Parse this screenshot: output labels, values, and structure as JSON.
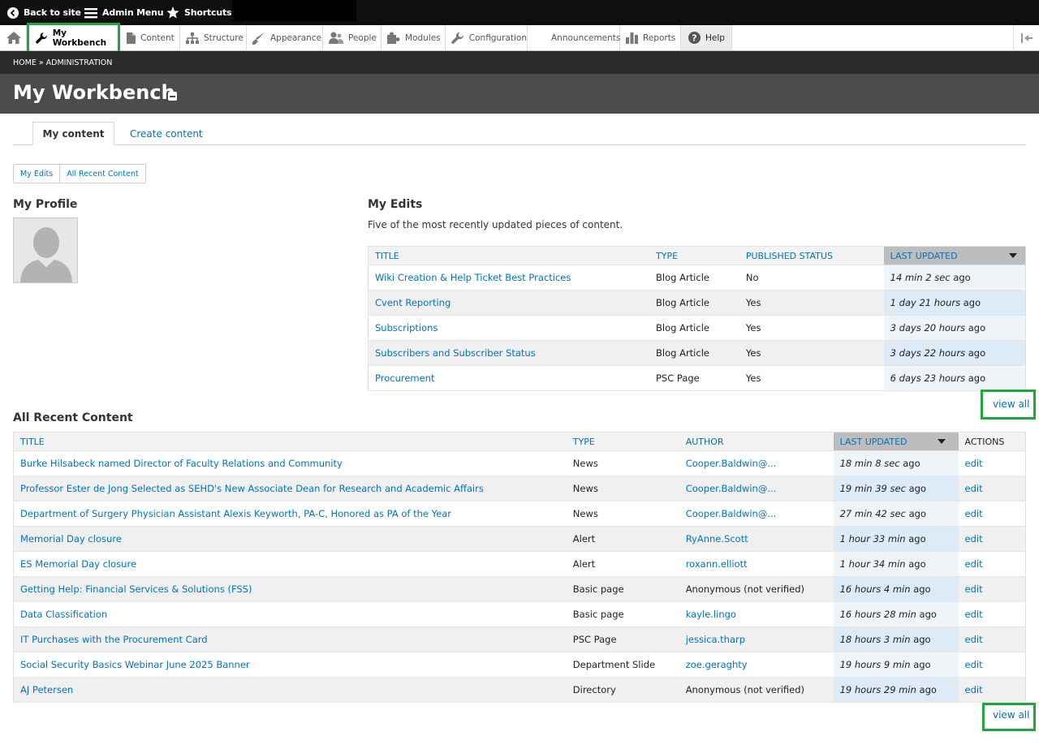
{
  "toolbar": {
    "back_to_site": "Back to site",
    "admin_menu": "Admin Menu",
    "shortcuts": "Shortcuts"
  },
  "tray": {
    "items": [
      {
        "label": "My Workbench"
      },
      {
        "label": "Content"
      },
      {
        "label": "Structure"
      },
      {
        "label": "Appearance"
      },
      {
        "label": "People"
      },
      {
        "label": "Modules"
      },
      {
        "label": "Configuration"
      },
      {
        "label": "Announcements"
      },
      {
        "label": "Reports"
      },
      {
        "label": "Help"
      }
    ]
  },
  "breadcrumb": "HOME » ADMINISTRATION",
  "page_title": "My Workbench",
  "tabs": {
    "active": "My content",
    "other": "Create content"
  },
  "local_buttons": [
    "My Edits",
    "All Recent Content"
  ],
  "profile": {
    "heading": "My Profile"
  },
  "my_edits": {
    "heading": "My Edits",
    "description": "Five of the most recently updated pieces of content.",
    "headers": [
      "TITLE",
      "TYPE",
      "PUBLISHED STATUS",
      "LAST UPDATED"
    ],
    "rows": [
      {
        "title": "Wiki Creation & Help Ticket Best Practices",
        "type": "Blog Article",
        "status": "No",
        "updated": "14 min 2 sec",
        "ago": " ago"
      },
      {
        "title": "Cvent Reporting",
        "type": "Blog Article",
        "status": "Yes",
        "updated": "1 day 21 hours",
        "ago": " ago"
      },
      {
        "title": "Subscriptions",
        "type": "Blog Article",
        "status": "Yes",
        "updated": "3 days 20 hours",
        "ago": " ago"
      },
      {
        "title": "Subscribers and Subscriber Status",
        "type": "Blog Article",
        "status": "Yes",
        "updated": "3 days 22 hours",
        "ago": " ago"
      },
      {
        "title": "Procurement",
        "type": "PSC Page",
        "status": "Yes",
        "updated": "6 days 23 hours",
        "ago": " ago"
      }
    ],
    "view_all": "view all"
  },
  "recent": {
    "heading": "All Recent Content",
    "headers": [
      "TITLE",
      "TYPE",
      "AUTHOR",
      "LAST UPDATED",
      "ACTIONS"
    ],
    "rows": [
      {
        "title": "Burke Hilsabeck named Director of Faculty Relations and Community",
        "type": "News",
        "author": "Cooper.Baldwin@...",
        "author_link": true,
        "updated": "18 min 8 sec",
        "ago": " ago",
        "action": "edit"
      },
      {
        "title": "Professor Ester de Jong Selected as SEHD's New Associate Dean for Research and Academic Affairs",
        "type": "News",
        "author": "Cooper.Baldwin@...",
        "author_link": true,
        "updated": "19 min 39 sec",
        "ago": " ago",
        "action": "edit"
      },
      {
        "title": "Department of Surgery Physician Assistant Alexis Keyworth, PA-C, Honored as PA of the Year",
        "type": "News",
        "author": "Cooper.Baldwin@...",
        "author_link": true,
        "updated": "27 min 42 sec",
        "ago": " ago",
        "action": "edit"
      },
      {
        "title": "Memorial Day closure",
        "type": "Alert",
        "author": "RyAnne.Scott",
        "author_link": true,
        "updated": "1 hour 33 min",
        "ago": " ago",
        "action": "edit"
      },
      {
        "title": "ES Memorial Day closure",
        "type": "Alert",
        "author": "roxann.elliott",
        "author_link": true,
        "updated": "1 hour 34 min",
        "ago": " ago",
        "action": "edit"
      },
      {
        "title": "Getting Help: Financial Services & Solutions (FSS)",
        "type": "Basic page",
        "author": "Anonymous (not verified)",
        "author_link": false,
        "updated": "16 hours 4 min",
        "ago": " ago",
        "action": "edit"
      },
      {
        "title": "Data Classification",
        "type": "Basic page",
        "author": "kayle.lingo",
        "author_link": true,
        "updated": "16 hours 28 min",
        "ago": " ago",
        "action": "edit"
      },
      {
        "title": "IT Purchases with the Procurement Card",
        "type": "PSC Page",
        "author": "jessica.tharp",
        "author_link": true,
        "updated": "18 hours 3 min",
        "ago": " ago",
        "action": "edit"
      },
      {
        "title": "Social Security Basics Webinar June 2025 Banner",
        "type": "Department Slide",
        "author": "zoe.geraghty",
        "author_link": true,
        "updated": "19 hours 9 min",
        "ago": " ago",
        "action": "edit"
      },
      {
        "title": "AJ Petersen",
        "type": "Directory",
        "author": "Anonymous (not verified)",
        "author_link": false,
        "updated": "19 hours 29 min",
        "ago": " ago",
        "action": "edit"
      }
    ],
    "view_all": "view all"
  },
  "colors": {
    "link": "#0074bd",
    "highlight": "#1fa83a",
    "toolbar": "#0f0f0f"
  }
}
